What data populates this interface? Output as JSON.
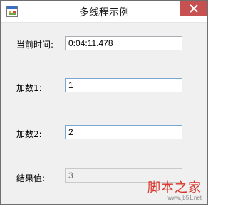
{
  "window": {
    "title": "多线程示例",
    "accent_close": "#c75050"
  },
  "form": {
    "time_label": "当前时间:",
    "time_value": "0:04:11.478",
    "add1_label": "加数1:",
    "add1_value": "1",
    "add2_label": "加数2:",
    "add2_value": "2",
    "result_label": "结果值:",
    "result_value": "3"
  },
  "watermark": {
    "brand": "脚本之家",
    "url": "www.jb51.net"
  },
  "icons": {
    "app": "app-window-icon",
    "close": "close-icon"
  }
}
